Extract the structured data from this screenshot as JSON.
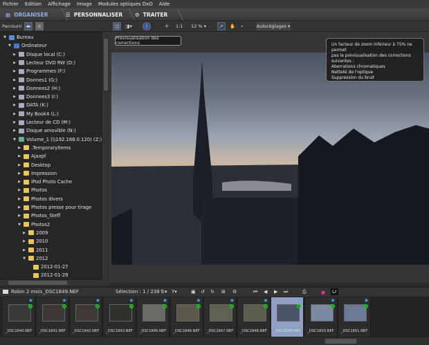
{
  "menu": [
    "Fichier",
    "Edition",
    "Affichage",
    "Image",
    "Modules optiques DxO",
    "Aide"
  ],
  "tabs": [
    {
      "label": "ORGANISER",
      "active": true
    },
    {
      "label": "PERSONNALISER"
    },
    {
      "label": "TRAITER"
    }
  ],
  "toolbar": {
    "browse_label": "Parcourir",
    "zoom_1to1": "1:1",
    "zoom_level": "12 %",
    "autoreglages": "Autoréglages"
  },
  "tooltip_preview": "Prévisualisation des corrections",
  "zoom_warning": [
    "Un facteur de zoom inférieur à 75% ne permet",
    "pas la prévisualisation des corrections",
    "suivantes :",
    "Aberrations chromatiques",
    "Netteté de l'optique",
    "Suppression du bruit"
  ],
  "tree": [
    {
      "label": "Bureau",
      "level": 0,
      "arrow": "▼",
      "icon": "desktop"
    },
    {
      "label": "Ordinateur",
      "level": 1,
      "arrow": "▼",
      "icon": "computer"
    },
    {
      "label": "Disque local (C:)",
      "level": 2,
      "arrow": "▶",
      "icon": "drive"
    },
    {
      "label": "Lecteur DVD RW (D:)",
      "level": 2,
      "arrow": "▶",
      "icon": "drive"
    },
    {
      "label": "Programmes (F:)",
      "level": 2,
      "arrow": "▶",
      "icon": "drive"
    },
    {
      "label": "Donnes1 (G:)",
      "level": 2,
      "arrow": "▶",
      "icon": "drive"
    },
    {
      "label": "Donnees2 (H:)",
      "level": 2,
      "arrow": "▶",
      "icon": "drive"
    },
    {
      "label": "Donnees3 (I:)",
      "level": 2,
      "arrow": "▶",
      "icon": "drive"
    },
    {
      "label": "DATA (K:)",
      "level": 2,
      "arrow": "▶",
      "icon": "drive"
    },
    {
      "label": "My Book4 (L:)",
      "level": 2,
      "arrow": "▶",
      "icon": "drive"
    },
    {
      "label": "Lecteur de CD (M:)",
      "level": 2,
      "arrow": "▶",
      "icon": "drive"
    },
    {
      "label": "Disque amovible (N:)",
      "level": 2,
      "arrow": "▶",
      "icon": "drive"
    },
    {
      "label": "Volume_1 (\\\\192.168.0.120) (Z:)",
      "level": 2,
      "arrow": "▼",
      "icon": "network"
    },
    {
      "label": ".TemporaryItems",
      "level": 3,
      "arrow": "▶",
      "icon": "folder"
    },
    {
      "label": "Ajaxpf",
      "level": 3,
      "arrow": "▶",
      "icon": "folder"
    },
    {
      "label": "Desktop",
      "level": 3,
      "arrow": "▶",
      "icon": "folder"
    },
    {
      "label": "Impression",
      "level": 3,
      "arrow": "▶",
      "icon": "folder"
    },
    {
      "label": "iPod Photo Cache",
      "level": 3,
      "arrow": "▶",
      "icon": "folder"
    },
    {
      "label": "Photos",
      "level": 3,
      "arrow": "▶",
      "icon": "folder"
    },
    {
      "label": "Photos divers",
      "level": 3,
      "arrow": "▶",
      "icon": "folder"
    },
    {
      "label": "Photos presse pour tirage",
      "level": 3,
      "arrow": "▶",
      "icon": "folder"
    },
    {
      "label": "Photos_Steff",
      "level": 3,
      "arrow": "▶",
      "icon": "folder"
    },
    {
      "label": "Photos2",
      "level": 3,
      "arrow": "▼",
      "icon": "folder"
    },
    {
      "label": "2009",
      "level": 4,
      "arrow": "▶",
      "icon": "folder"
    },
    {
      "label": "2010",
      "level": 4,
      "arrow": "▶",
      "icon": "folder"
    },
    {
      "label": "2011",
      "level": 4,
      "arrow": "▶",
      "icon": "folder"
    },
    {
      "label": "2012",
      "level": 4,
      "arrow": "▼",
      "icon": "folder"
    },
    {
      "label": "2012-01-27",
      "level": 5,
      "arrow": "",
      "icon": "folder"
    },
    {
      "label": "2012-01-29",
      "level": 5,
      "arrow": "",
      "icon": "folder"
    }
  ],
  "filmstrip": {
    "folder": "Robin 2 mois",
    "current_file": "_DSC1849.NEF",
    "selection": "Sélection : 1 / 238",
    "lr": "Lr",
    "thumbs": [
      {
        "name": "_DSC1840.NEF",
        "color": "#3a3a38"
      },
      {
        "name": "_DSC1841.NEF",
        "color": "#3c3836"
      },
      {
        "name": "_DSC1842.NEF",
        "color": "#3e3a36"
      },
      {
        "name": "_DSC1843.NEF",
        "color": "#2e302c"
      },
      {
        "name": "_DSC1845.NEF",
        "color": "#6a6a66"
      },
      {
        "name": "_DSC1846.NEF",
        "color": "#5a5848"
      },
      {
        "name": "_DSC1847.NEF",
        "color": "#5e6050"
      },
      {
        "name": "_DSC1848.NEF",
        "color": "#5a5c4c"
      },
      {
        "name": "_DSC1849.NEF",
        "color": "#4a5468",
        "selected": true
      },
      {
        "name": "_DSC1850.NEF",
        "color": "#7a8aa0"
      },
      {
        "name": "_DSC1851.NEF",
        "color": "#6a7a94"
      }
    ]
  },
  "colors": {
    "accent": "#4b5a6e",
    "selected_thumb": "#8fa0c4",
    "star": "#36b5f0",
    "folder": "#e8c65a"
  }
}
